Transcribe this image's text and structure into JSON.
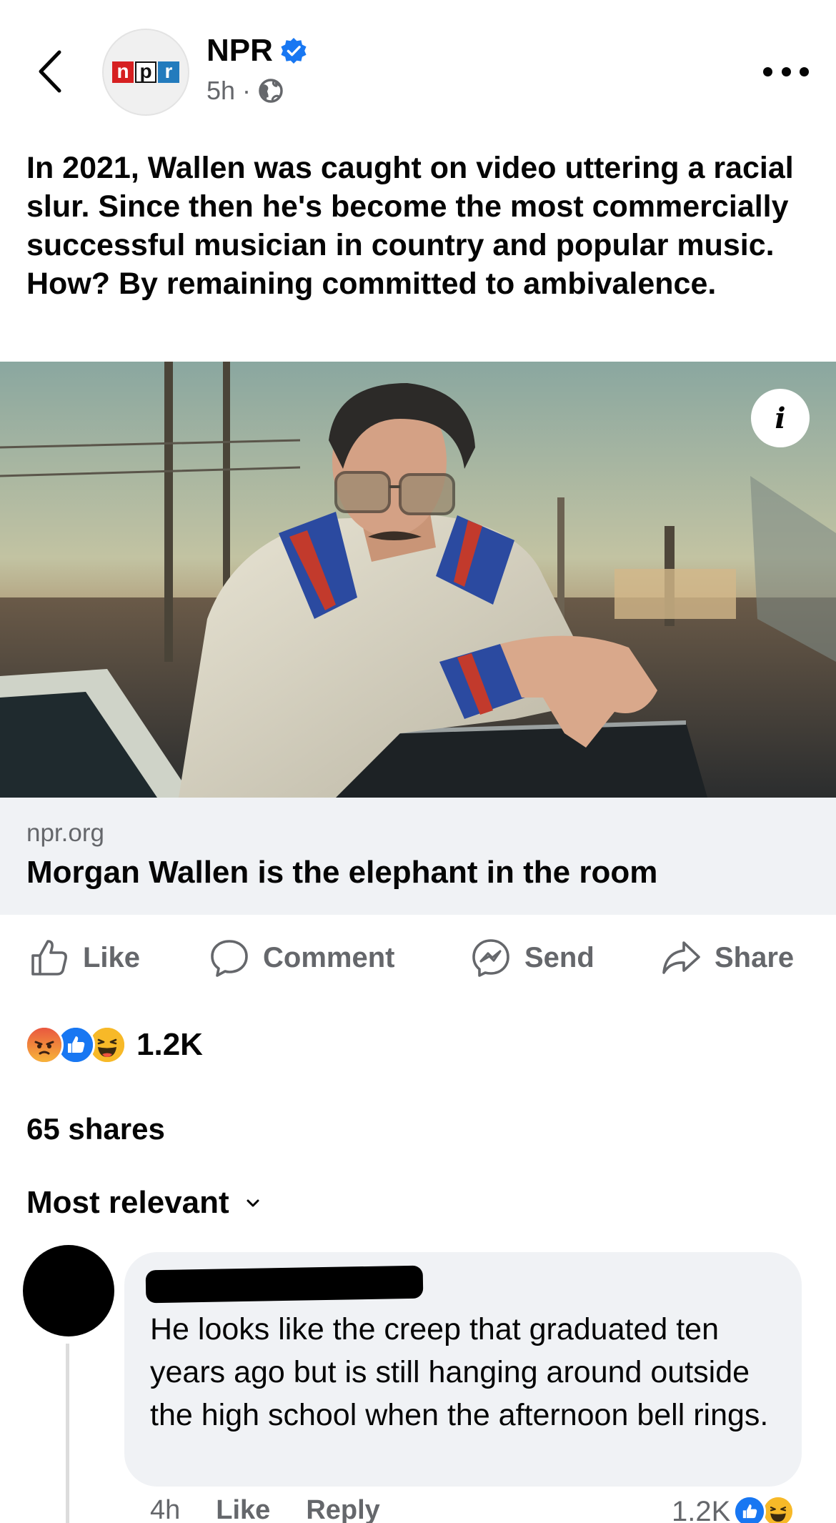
{
  "header": {
    "page_name": "NPR",
    "time": "5h",
    "separator": "·",
    "avatar_logo": [
      "n",
      "p",
      "r"
    ]
  },
  "post": {
    "text": "In 2021, Wallen was caught on video uttering a racial slur. Since then he's become the most commercially successful musician in country and popular music. How? By remaining committed to ambivalence.",
    "info_label": "i"
  },
  "link_card": {
    "domain": "npr.org",
    "title": "Morgan Wallen is the elephant in the room"
  },
  "actions": {
    "like": "Like",
    "comment": "Comment",
    "send": "Send",
    "share": "Share"
  },
  "reactions": {
    "count": "1.2K",
    "types": [
      "angry",
      "like",
      "haha"
    ]
  },
  "shares_text": "65 shares",
  "sort_label": "Most relevant",
  "comment": {
    "text": "He looks like the creep that graduated ten years ago but is still hanging around outside the high school when the afternoon bell rings.",
    "time": "4h",
    "like_label": "Like",
    "reply_label": "Reply",
    "reaction_count": "1.2K",
    "reaction_types": [
      "like",
      "haha"
    ]
  },
  "colors": {
    "brand_blue": "#1877f2",
    "secondary_text": "#65676b",
    "card_bg": "#f0f2f5",
    "npr_red": "#d62021",
    "npr_blue": "#237bbd"
  }
}
